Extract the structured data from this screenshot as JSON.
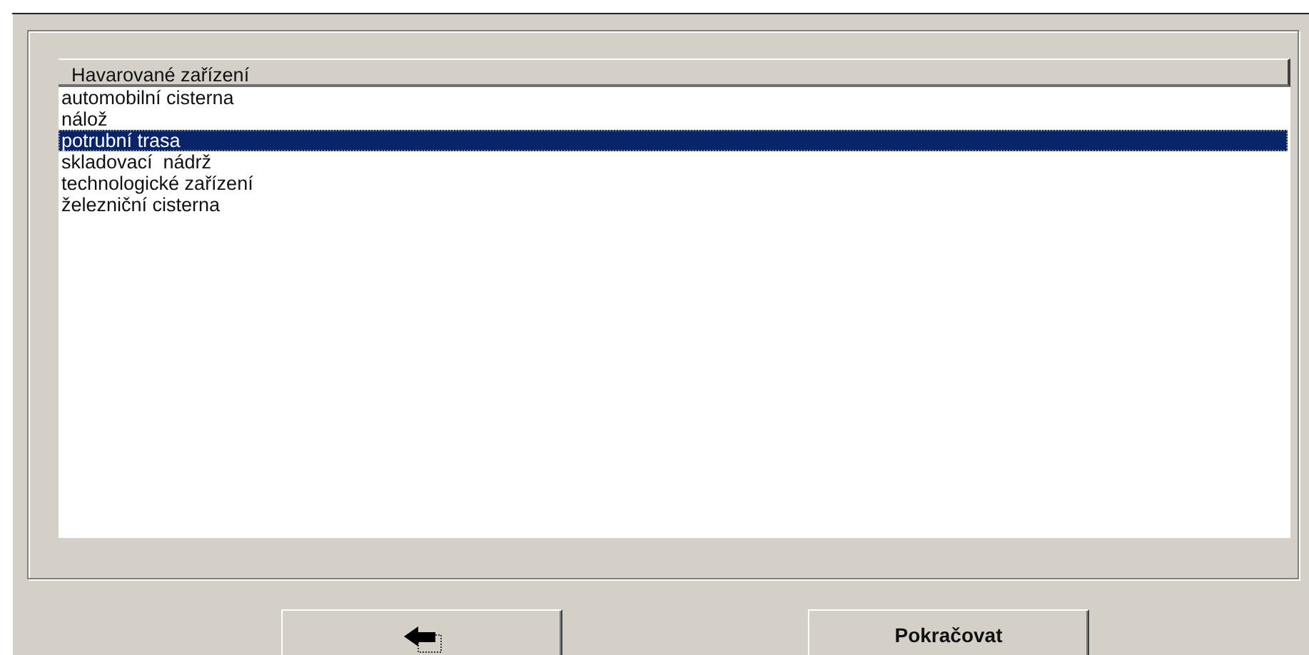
{
  "list": {
    "column": "Havarované zařízení",
    "items": [
      {
        "label": "automobilní cisterna",
        "selected": false
      },
      {
        "label": "nálož",
        "selected": false
      },
      {
        "label": "potrubní trasa",
        "selected": true
      },
      {
        "label": "skladovací  nádrž",
        "selected": false
      },
      {
        "label": "technologické zařízení",
        "selected": false
      },
      {
        "label": "železniční cisterna",
        "selected": false
      }
    ]
  },
  "buttons": [
    {
      "kind": "back"
    },
    {
      "kind": "text",
      "label": "Pokračovat"
    }
  ]
}
